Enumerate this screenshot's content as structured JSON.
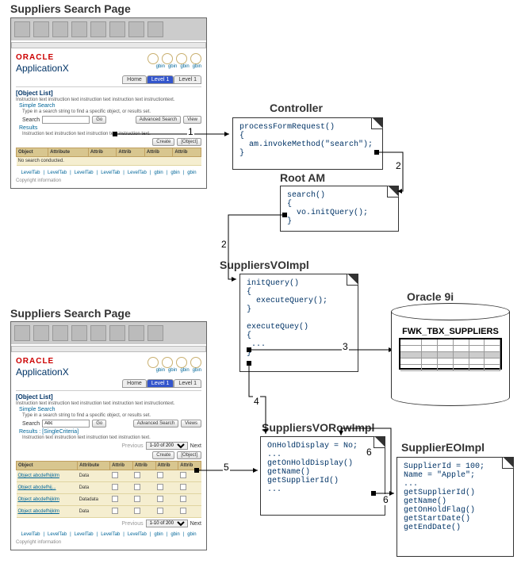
{
  "headings": {
    "thumb1": "Suppliers Search Page",
    "thumb2": "Suppliers Search Page",
    "controller": "Controller",
    "rootam": "Root AM",
    "voimpl": "SuppliersVOImpl",
    "vorowimpl": "SuppliersVORowImpl",
    "eoimpl": "SupplierEOImpl",
    "db": "Oracle 9i"
  },
  "arrow_labels": {
    "a1": "1",
    "a2a": "2",
    "a2b": "2",
    "a3": "3",
    "a4": "4",
    "a5": "5",
    "a6a": "6",
    "a6b": "6"
  },
  "thumb": {
    "brand": "ORACLE",
    "app": "ApplicationX",
    "global": "gbin",
    "tabs": {
      "home": "Home",
      "l1a": "Level 1",
      "l1b": "Level 1"
    },
    "ol": "[Object List]",
    "instr": "Instruction text instruction text instruction text instruction text instructiontext.",
    "simple": "Simple Search",
    "tip": "Type in a search string to find a specific object, or results set.",
    "searchlabel": "Search",
    "go": "Go",
    "advanced": "Advanced Search",
    "view": "View",
    "views": "Views",
    "results": "Results",
    "results_sc": "Results : [SingleCriteria]",
    "instr2": "Instruction text instruction text instruction text instruction text.",
    "create": "Create",
    "objbtn": "[Object]",
    "th": {
      "obj": "Object",
      "attribute": "Attribute",
      "attrib": "Attrib"
    },
    "empty": "No search conducted.",
    "search_val": "Abc",
    "row_obj": "Object abcdefhijklm",
    "row_obj_diff": "Object abcdefhij...",
    "row_attr": "Data",
    "row_attr_date": "Datadata",
    "prev": "Previous",
    "pager": "1-10 of 200",
    "next": "Next",
    "ftab": "LevelTab",
    "copy": "Copyright information"
  },
  "code": {
    "controller": "processFormRequest()\n{\n  am.invokeMethod(\"search\");\n}",
    "rootam": "search()\n{\n  vo.initQuery();\n}",
    "voimpl": "initQuery()\n{\n  executeQuery();\n}\n\nexecuteQuey()\n{\n ...\n}",
    "vorowimpl": "OnHoldDisplay = No;\n...\ngetOnHoldDisplay()\ngetName()\ngetSupplierId()\n...",
    "eoimpl": "SupplierId = 100;\nName = \"Apple\";\n...\ngetSupplierId()\ngetName()\ngetOnHoldFlag()\ngetStartDate()\ngetEndDate()"
  },
  "db": {
    "table": "FWK_TBX_SUPPLIERS"
  }
}
